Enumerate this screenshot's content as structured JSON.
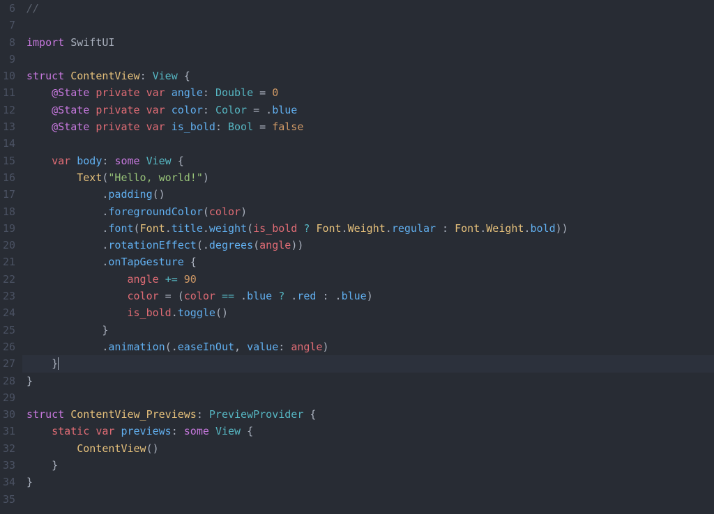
{
  "first_line_number": 6,
  "cursor_line_index": 21,
  "lines": [
    [
      {
        "c": "cm",
        "t": "//"
      }
    ],
    [],
    [
      {
        "c": "kw",
        "t": "import"
      },
      {
        "c": "id",
        "t": " SwiftUI"
      }
    ],
    [],
    [
      {
        "c": "kw",
        "t": "struct"
      },
      {
        "c": "id",
        "t": " "
      },
      {
        "c": "type",
        "t": "ContentView"
      },
      {
        "c": "id",
        "t": ": "
      },
      {
        "c": "tcy",
        "t": "View"
      },
      {
        "c": "id",
        "t": " {"
      }
    ],
    [
      {
        "c": "id",
        "t": "    "
      },
      {
        "c": "attrkw",
        "t": "@State"
      },
      {
        "c": "id",
        "t": " "
      },
      {
        "c": "kw2",
        "t": "private"
      },
      {
        "c": "id",
        "t": " "
      },
      {
        "c": "kw2",
        "t": "var"
      },
      {
        "c": "id",
        "t": " "
      },
      {
        "c": "fn",
        "t": "angle"
      },
      {
        "c": "id",
        "t": ": "
      },
      {
        "c": "tcy",
        "t": "Double"
      },
      {
        "c": "id",
        "t": " = "
      },
      {
        "c": "num",
        "t": "0"
      }
    ],
    [
      {
        "c": "id",
        "t": "    "
      },
      {
        "c": "attrkw",
        "t": "@State"
      },
      {
        "c": "id",
        "t": " "
      },
      {
        "c": "kw2",
        "t": "private"
      },
      {
        "c": "id",
        "t": " "
      },
      {
        "c": "kw2",
        "t": "var"
      },
      {
        "c": "id",
        "t": " "
      },
      {
        "c": "fn",
        "t": "color"
      },
      {
        "c": "id",
        "t": ": "
      },
      {
        "c": "tcy",
        "t": "Color"
      },
      {
        "c": "id",
        "t": " = ."
      },
      {
        "c": "fn",
        "t": "blue"
      }
    ],
    [
      {
        "c": "id",
        "t": "    "
      },
      {
        "c": "attrkw",
        "t": "@State"
      },
      {
        "c": "id",
        "t": " "
      },
      {
        "c": "kw2",
        "t": "private"
      },
      {
        "c": "id",
        "t": " "
      },
      {
        "c": "kw2",
        "t": "var"
      },
      {
        "c": "id",
        "t": " "
      },
      {
        "c": "fn",
        "t": "is_bold"
      },
      {
        "c": "id",
        "t": ": "
      },
      {
        "c": "tcy",
        "t": "Bool"
      },
      {
        "c": "id",
        "t": " = "
      },
      {
        "c": "num",
        "t": "false"
      }
    ],
    [],
    [
      {
        "c": "id",
        "t": "    "
      },
      {
        "c": "kw2",
        "t": "var"
      },
      {
        "c": "id",
        "t": " "
      },
      {
        "c": "fn",
        "t": "body"
      },
      {
        "c": "id",
        "t": ": "
      },
      {
        "c": "kw",
        "t": "some"
      },
      {
        "c": "id",
        "t": " "
      },
      {
        "c": "tcy",
        "t": "View"
      },
      {
        "c": "id",
        "t": " {"
      }
    ],
    [
      {
        "c": "id",
        "t": "        "
      },
      {
        "c": "type",
        "t": "Text"
      },
      {
        "c": "id",
        "t": "("
      },
      {
        "c": "str",
        "t": "\"Hello, world!\""
      },
      {
        "c": "id",
        "t": ")"
      }
    ],
    [
      {
        "c": "id",
        "t": "            ."
      },
      {
        "c": "fn",
        "t": "padding"
      },
      {
        "c": "id",
        "t": "()"
      }
    ],
    [
      {
        "c": "id",
        "t": "            ."
      },
      {
        "c": "fn",
        "t": "foregroundColor"
      },
      {
        "c": "id",
        "t": "("
      },
      {
        "c": "idr",
        "t": "color"
      },
      {
        "c": "id",
        "t": ")"
      }
    ],
    [
      {
        "c": "id",
        "t": "            ."
      },
      {
        "c": "fn",
        "t": "font"
      },
      {
        "c": "id",
        "t": "("
      },
      {
        "c": "type",
        "t": "Font"
      },
      {
        "c": "id",
        "t": "."
      },
      {
        "c": "fn",
        "t": "title"
      },
      {
        "c": "id",
        "t": "."
      },
      {
        "c": "fn",
        "t": "weight"
      },
      {
        "c": "id",
        "t": "("
      },
      {
        "c": "idr",
        "t": "is_bold"
      },
      {
        "c": "id",
        "t": " "
      },
      {
        "c": "op2",
        "t": "?"
      },
      {
        "c": "id",
        "t": " "
      },
      {
        "c": "type",
        "t": "Font"
      },
      {
        "c": "id",
        "t": "."
      },
      {
        "c": "type",
        "t": "Weight"
      },
      {
        "c": "id",
        "t": "."
      },
      {
        "c": "fn",
        "t": "regular"
      },
      {
        "c": "id",
        "t": " : "
      },
      {
        "c": "type",
        "t": "Font"
      },
      {
        "c": "id",
        "t": "."
      },
      {
        "c": "type",
        "t": "Weight"
      },
      {
        "c": "id",
        "t": "."
      },
      {
        "c": "fn",
        "t": "bold"
      },
      {
        "c": "id",
        "t": "))"
      }
    ],
    [
      {
        "c": "id",
        "t": "            ."
      },
      {
        "c": "fn",
        "t": "rotationEffect"
      },
      {
        "c": "id",
        "t": "(."
      },
      {
        "c": "fn",
        "t": "degrees"
      },
      {
        "c": "id",
        "t": "("
      },
      {
        "c": "idr",
        "t": "angle"
      },
      {
        "c": "id",
        "t": "))"
      }
    ],
    [
      {
        "c": "id",
        "t": "            ."
      },
      {
        "c": "fn",
        "t": "onTapGesture"
      },
      {
        "c": "id",
        "t": " {"
      }
    ],
    [
      {
        "c": "id",
        "t": "                "
      },
      {
        "c": "idr",
        "t": "angle"
      },
      {
        "c": "id",
        "t": " "
      },
      {
        "c": "op2",
        "t": "+="
      },
      {
        "c": "id",
        "t": " "
      },
      {
        "c": "num",
        "t": "90"
      }
    ],
    [
      {
        "c": "id",
        "t": "                "
      },
      {
        "c": "idr",
        "t": "color"
      },
      {
        "c": "id",
        "t": " = ("
      },
      {
        "c": "idr",
        "t": "color"
      },
      {
        "c": "id",
        "t": " "
      },
      {
        "c": "op2",
        "t": "=="
      },
      {
        "c": "id",
        "t": " ."
      },
      {
        "c": "fn",
        "t": "blue"
      },
      {
        "c": "id",
        "t": " "
      },
      {
        "c": "op2",
        "t": "?"
      },
      {
        "c": "id",
        "t": " ."
      },
      {
        "c": "fn",
        "t": "red"
      },
      {
        "c": "id",
        "t": " : ."
      },
      {
        "c": "fn",
        "t": "blue"
      },
      {
        "c": "id",
        "t": ")"
      }
    ],
    [
      {
        "c": "id",
        "t": "                "
      },
      {
        "c": "idr",
        "t": "is_bold"
      },
      {
        "c": "id",
        "t": "."
      },
      {
        "c": "fn",
        "t": "toggle"
      },
      {
        "c": "id",
        "t": "()"
      }
    ],
    [
      {
        "c": "id",
        "t": "            }"
      }
    ],
    [
      {
        "c": "id",
        "t": "            ."
      },
      {
        "c": "fn",
        "t": "animation"
      },
      {
        "c": "id",
        "t": "(."
      },
      {
        "c": "fn",
        "t": "easeInOut"
      },
      {
        "c": "id",
        "t": ", "
      },
      {
        "c": "fn",
        "t": "value"
      },
      {
        "c": "id",
        "t": ": "
      },
      {
        "c": "idr",
        "t": "angle"
      },
      {
        "c": "id",
        "t": ")"
      }
    ],
    [
      {
        "c": "id",
        "t": "    }"
      }
    ],
    [
      {
        "c": "id",
        "t": "}"
      }
    ],
    [],
    [
      {
        "c": "kw",
        "t": "struct"
      },
      {
        "c": "id",
        "t": " "
      },
      {
        "c": "type",
        "t": "ContentView_Previews"
      },
      {
        "c": "id",
        "t": ": "
      },
      {
        "c": "tcy",
        "t": "PreviewProvider"
      },
      {
        "c": "id",
        "t": " {"
      }
    ],
    [
      {
        "c": "id",
        "t": "    "
      },
      {
        "c": "kw2",
        "t": "static"
      },
      {
        "c": "id",
        "t": " "
      },
      {
        "c": "kw2",
        "t": "var"
      },
      {
        "c": "id",
        "t": " "
      },
      {
        "c": "fn",
        "t": "previews"
      },
      {
        "c": "id",
        "t": ": "
      },
      {
        "c": "kw",
        "t": "some"
      },
      {
        "c": "id",
        "t": " "
      },
      {
        "c": "tcy",
        "t": "View"
      },
      {
        "c": "id",
        "t": " {"
      }
    ],
    [
      {
        "c": "id",
        "t": "        "
      },
      {
        "c": "type",
        "t": "ContentView"
      },
      {
        "c": "id",
        "t": "()"
      }
    ],
    [
      {
        "c": "id",
        "t": "    }"
      }
    ],
    [
      {
        "c": "id",
        "t": "}"
      }
    ],
    []
  ]
}
